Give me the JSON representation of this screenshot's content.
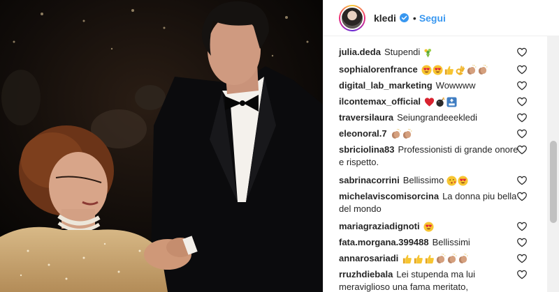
{
  "post": {
    "username": "kledi",
    "separator": "•",
    "follow_label": "Segui"
  },
  "comments": [
    {
      "user": "julia.deda",
      "text": "Stupendi",
      "emojis": [
        "bouquet"
      ]
    },
    {
      "user": "sophialorenfrance",
      "text": "",
      "emojis": [
        "heart-eyes",
        "heart-eyes",
        "thumbs-up",
        "ok-hand",
        "clap",
        "clap"
      ]
    },
    {
      "user": "digital_lab_marketing",
      "text": "Wowwww",
      "emojis": []
    },
    {
      "user": "ilcontemax_official",
      "text": "",
      "emojis": [
        "red-heart",
        "bomb",
        "top-arrow"
      ]
    },
    {
      "user": "traversilaura",
      "text": "Seiungrandeeekledi",
      "emojis": []
    },
    {
      "user": "eleonoral.7",
      "text": "",
      "emojis": [
        "clap",
        "clap"
      ]
    },
    {
      "user": "sbriciolina83",
      "text": "Professionisti di grande onore e rispetto.",
      "emojis": []
    },
    {
      "user": "sabrinacorrini",
      "text": "Bellissimo",
      "emojis": [
        "kiss-face",
        "heart-eyes"
      ]
    },
    {
      "user": "michelaviscomisorcina",
      "text": "La donna piu bella del mondo",
      "emojis": []
    },
    {
      "user": "mariagraziadignoti",
      "text": "",
      "emojis": [
        "heart-eyes"
      ]
    },
    {
      "user": "fata.morgana.399488",
      "text": "Bellissimi",
      "emojis": []
    },
    {
      "user": "annarosariadi",
      "text": "",
      "emojis": [
        "thumbs-up",
        "thumbs-up",
        "thumbs-up",
        "clap",
        "clap",
        "clap"
      ]
    },
    {
      "user": "rruzhdiebala",
      "text": "Lei stupenda ma lui meraviglioso una fama meritato,",
      "emojis": []
    }
  ],
  "icons": {
    "verified": "verified-badge-icon",
    "like": "heart-outline-icon"
  },
  "colors": {
    "link_blue": "#3897f0",
    "verified_blue": "#3897f0",
    "text": "#262626",
    "border": "#efefef"
  }
}
